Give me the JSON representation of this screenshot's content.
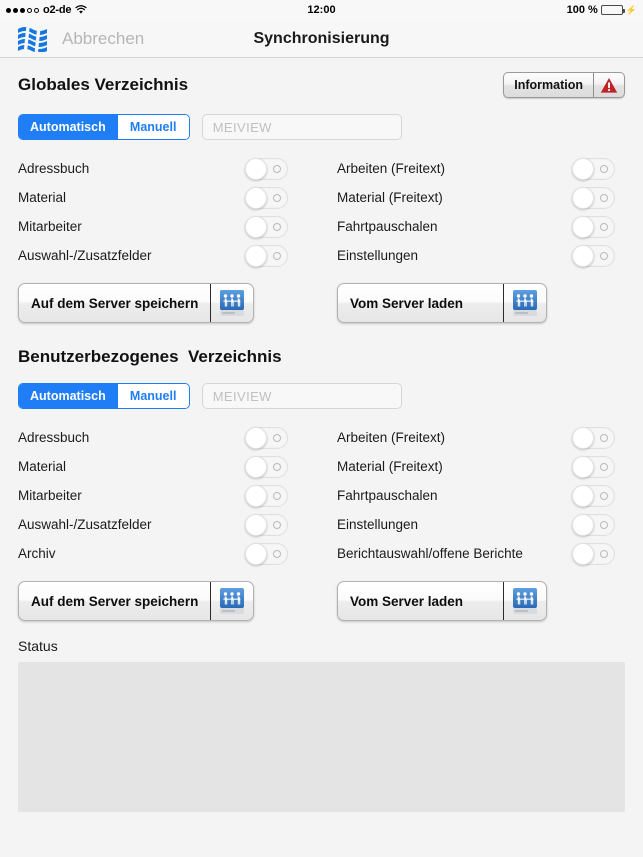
{
  "status_bar": {
    "carrier": "o2-de",
    "signal_filled": 3,
    "signal_total": 5,
    "wifi_icon": "wifi-icon",
    "time": "12:00",
    "battery_percent": "100 %",
    "battery_level": 100,
    "charging_icon": "lightning-bolt-icon"
  },
  "nav": {
    "logo_icon": "app-logo-waves-icon",
    "cancel_label": "Abbrechen",
    "title": "Synchronisierung"
  },
  "colors": {
    "accent_blue": "#1f7ef6",
    "logo_blue": "#1578e0",
    "warning_red": "#c0232b",
    "battery_green": "#4cd45e",
    "page_background": "#f4f4f4",
    "status_box": "#e4e4e4"
  },
  "global_section": {
    "title": "Globales Verzeichnis",
    "information_button": {
      "label": "Information",
      "icon": "warning-triangle-icon"
    },
    "mode": {
      "options": [
        "Automatisch",
        "Manuell"
      ],
      "selected": "Automatisch"
    },
    "name_field": {
      "value": "",
      "placeholder": "MEIVIEW"
    },
    "left_toggles": [
      {
        "label": "Adressbuch",
        "on": false
      },
      {
        "label": "Material",
        "on": false
      },
      {
        "label": "Mitarbeiter",
        "on": false
      },
      {
        "label": "Auswahl-/Zusatzfelder",
        "on": false
      }
    ],
    "right_toggles": [
      {
        "label": "Arbeiten (Freitext)",
        "on": false
      },
      {
        "label": "Material (Freitext)",
        "on": false
      },
      {
        "label": "Fahrtpauschalen",
        "on": false
      },
      {
        "label": "Einstellungen",
        "on": false
      }
    ],
    "save_button": {
      "label": "Auf dem Server speichern",
      "icon": "network-drive-icon"
    },
    "load_button": {
      "label": "Vom Server laden",
      "icon": "network-drive-icon"
    }
  },
  "user_section": {
    "title": "Benutzerbezogenes  Verzeichnis",
    "mode": {
      "options": [
        "Automatisch",
        "Manuell"
      ],
      "selected": "Automatisch"
    },
    "name_field": {
      "value": "",
      "placeholder": "MEIVIEW"
    },
    "left_toggles": [
      {
        "label": "Adressbuch",
        "on": false
      },
      {
        "label": "Material",
        "on": false
      },
      {
        "label": "Mitarbeiter",
        "on": false
      },
      {
        "label": "Auswahl-/Zusatzfelder",
        "on": false
      },
      {
        "label": "Archiv",
        "on": false
      }
    ],
    "right_toggles": [
      {
        "label": "Arbeiten (Freitext)",
        "on": false
      },
      {
        "label": "Material (Freitext)",
        "on": false
      },
      {
        "label": "Fahrtpauschalen",
        "on": false
      },
      {
        "label": "Einstellungen",
        "on": false
      },
      {
        "label": "Berichtauswahl/offene Berichte",
        "on": false
      }
    ],
    "save_button": {
      "label": "Auf dem Server speichern",
      "icon": "network-drive-icon"
    },
    "load_button": {
      "label": "Vom Server laden",
      "icon": "network-drive-icon"
    }
  },
  "status": {
    "label": "Status",
    "text": ""
  }
}
